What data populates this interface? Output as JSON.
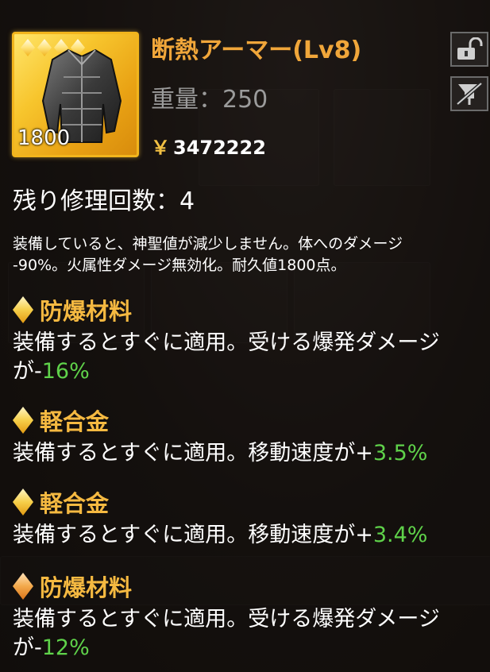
{
  "item": {
    "name": "断熱アーマー(Lv8)",
    "weight": "重量：250",
    "currency_symbol": "￥",
    "price": "3472222",
    "durability": "1800",
    "rarity_stars": 4
  },
  "side_buttons": {
    "lock_icon": "unlock-icon",
    "pin_icon": "unpin-icon"
  },
  "repair_label": "残り修理回数：4",
  "description_lines": [
    "装備していると、神聖値が減少しません。体へのダメージ",
    "-90%。火属性ダメージ無効化。耐久値1800点。"
  ],
  "mods": [
    {
      "name": "防爆材料",
      "diamond_color": "#f6cf4a",
      "line1": "装備するとすぐに適用。受ける爆発ダメージ",
      "line2_prefix": "が-",
      "value": "16%"
    },
    {
      "name": "軽合金",
      "diamond_color": "#f6cf4a",
      "line1_prefix": "装備するとすぐに適用。移動速度が+",
      "value": "3.5%"
    },
    {
      "name": "軽合金",
      "diamond_color": "#f6cf4a",
      "line1_prefix": "装備するとすぐに適用。移動速度が+",
      "value": "3.4%"
    },
    {
      "name": "防爆材料",
      "diamond_color": "#f3a94b",
      "line1": "装備するとすぐに適用。受ける爆発ダメージ",
      "line2_prefix": "が-",
      "value": "12%"
    }
  ],
  "colors": {
    "name": "#f0a63a",
    "mod_name": "#f5b941",
    "positive_value": "#5fd24a",
    "weight": "#9b9b9b"
  }
}
